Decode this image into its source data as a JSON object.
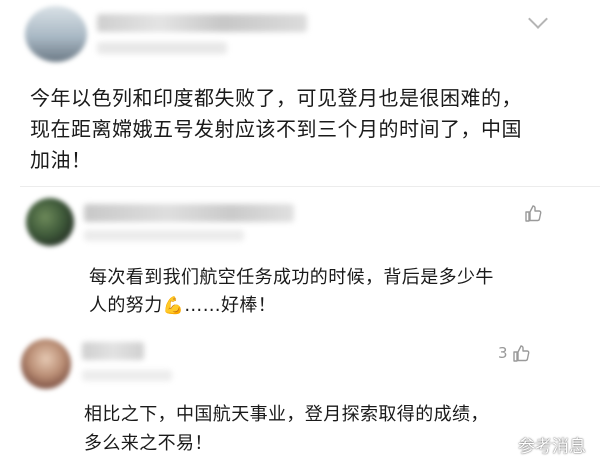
{
  "comments": [
    {
      "text_lines": [
        "今年以色列和印度都失败了，可见登月也是很困难的，",
        "现在距离嫦娥五号发射应该不到三个月的时间了，中国",
        "加油！"
      ]
    }
  ],
  "replies": [
    {
      "text_line1": "每次看到我们航空任务成功的时候，背后是多少牛",
      "text_line2_prefix": "人的努力",
      "emoji": "💪",
      "text_line2_suffix": "……好棒！",
      "likes": ""
    },
    {
      "text_lines": [
        "相比之下，中国航天事业，登月探索取得的成绩，",
        "多么来之不易！"
      ],
      "likes": "3"
    }
  ],
  "watermark": {
    "text": "参考消息",
    "icon": "weibo-icon"
  },
  "icons": {
    "more": "chevron-down-icon",
    "like": "thumb-up-icon"
  },
  "colors": {
    "background": "#ffffff",
    "text": "#1a1a1a",
    "muted": "#999999"
  }
}
